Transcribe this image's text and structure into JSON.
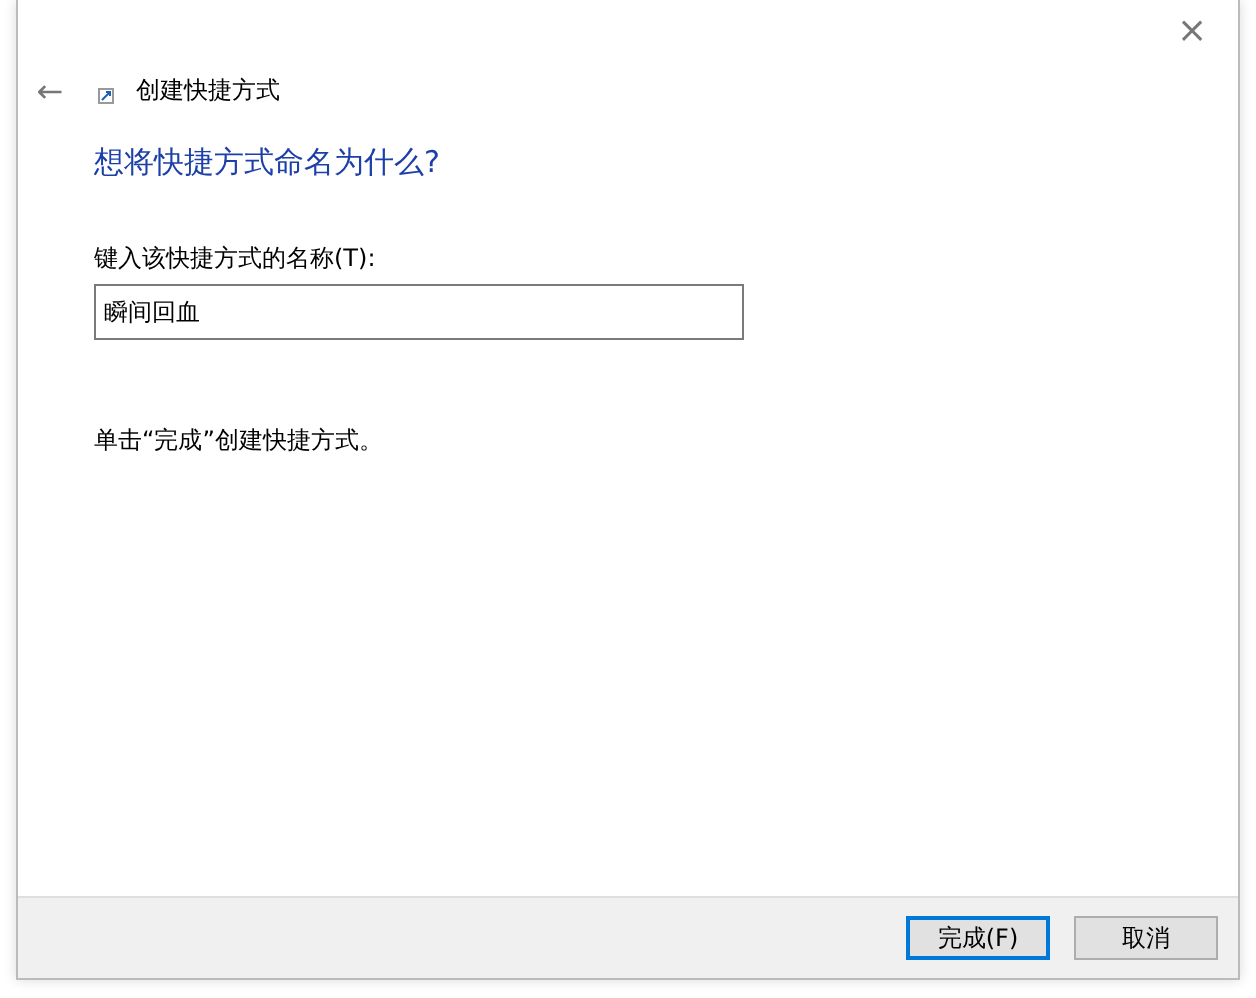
{
  "window": {
    "title": "创建快捷方式",
    "close": "×",
    "back": "←"
  },
  "heading": "想将快捷方式命名为什么?",
  "name_field": {
    "label": "键入该快捷方式的名称(T):",
    "value": "瞬间回血"
  },
  "instruction": "单击“完成”创建快捷方式。",
  "buttons": [
    {
      "label": "完成(F)",
      "default": true
    },
    {
      "label": "取消",
      "default": false
    }
  ]
}
